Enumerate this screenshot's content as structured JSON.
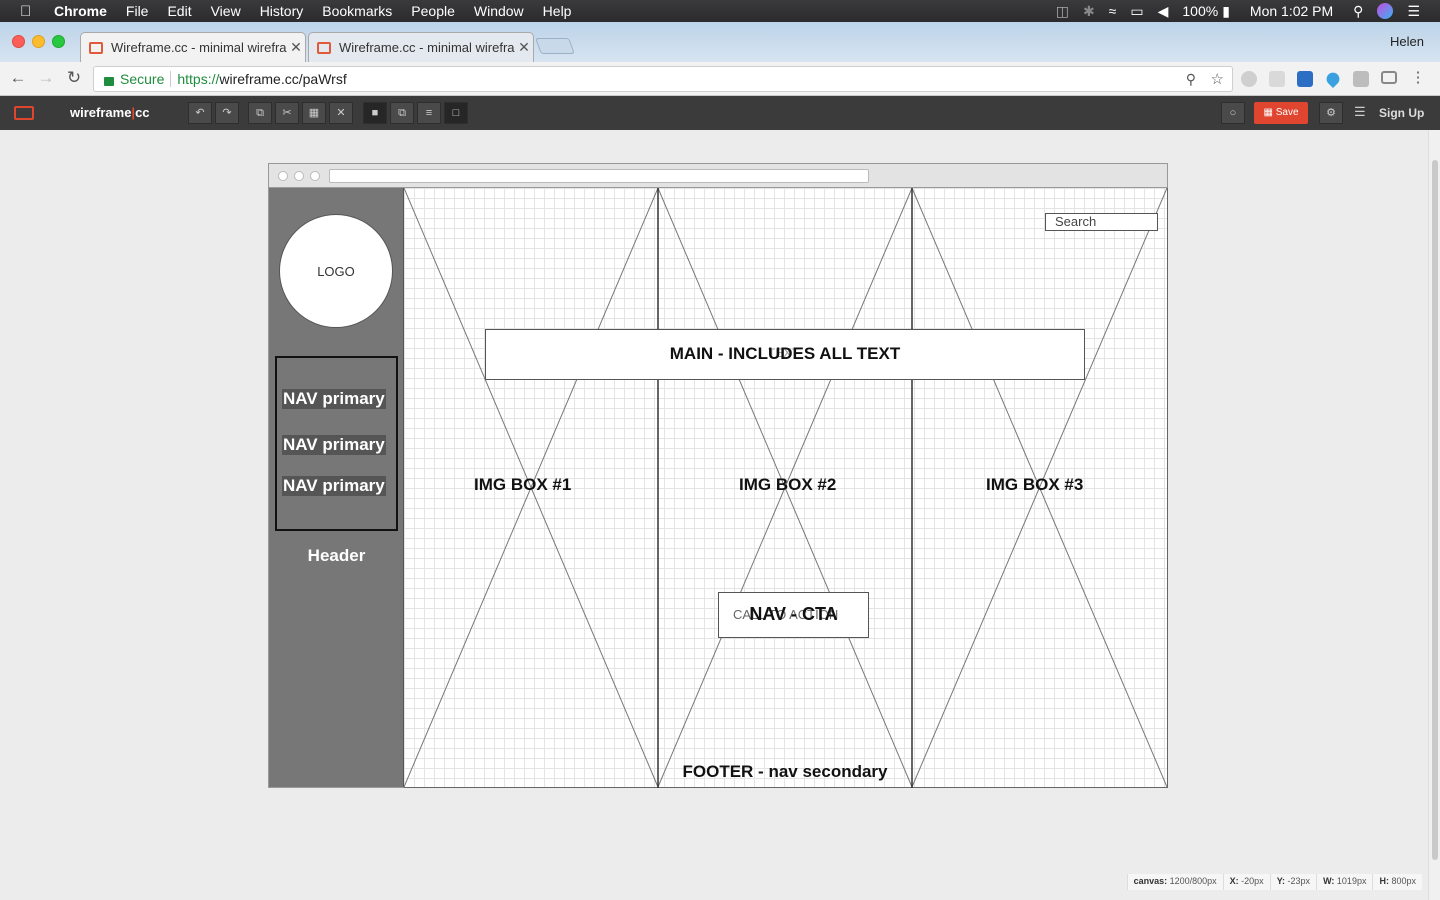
{
  "menubar": {
    "app": "Chrome",
    "items": [
      "File",
      "Edit",
      "View",
      "History",
      "Bookmarks",
      "People",
      "Window",
      "Help"
    ],
    "battery": "100%",
    "clock": "Mon 1:02 PM"
  },
  "browser": {
    "tabs": [
      {
        "title": "Wireframe.cc - minimal wirefra"
      },
      {
        "title": "Wireframe.cc - minimal wirefra"
      }
    ],
    "profile": "Helen",
    "secure_label": "Secure",
    "url_scheme": "https://",
    "url_rest": "wireframe.cc/paWrsf"
  },
  "app_toolbar": {
    "brand_left": "wireframe",
    "brand_pipe": "|",
    "brand_right": "cc",
    "save_label": "Save",
    "signup_label": "Sign Up"
  },
  "wireframe": {
    "logo": "LOGO",
    "nav_items": [
      "NAV primary",
      "NAV primary",
      "NAV primary"
    ],
    "sidebar_header": "Header",
    "main_label": "MAIN - INCLUDES ALL TEXT",
    "main_ghost": "TEXT",
    "img_boxes": [
      "IMG BOX #1",
      "IMG BOX #2",
      "IMG BOX #3"
    ],
    "cta_label": "NAV - CTA",
    "cta_ghost": "CALL TO ACTION",
    "footer": "FOOTER - nav secondary",
    "search": "Search"
  },
  "statusbar": {
    "canvas_key": "canvas:",
    "canvas_val": "1200/800px",
    "x_key": "X:",
    "x_val": "-20px",
    "y_key": "Y:",
    "y_val": "-23px",
    "w_key": "W:",
    "w_val": "1019px",
    "h_key": "H:",
    "h_val": "800px"
  }
}
